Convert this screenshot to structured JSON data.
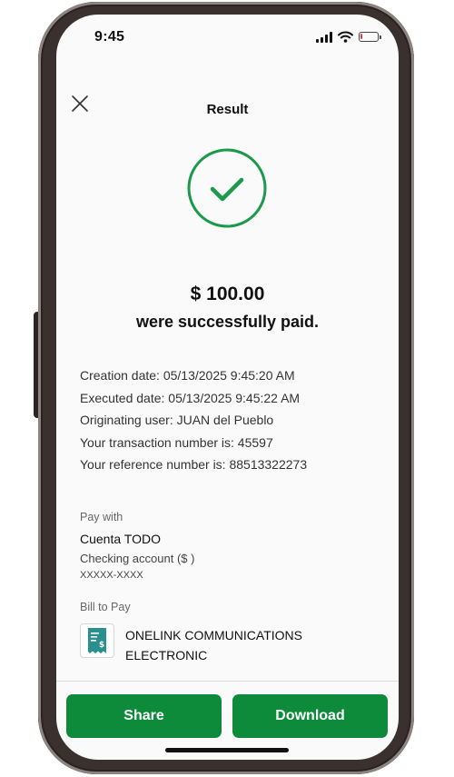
{
  "status_bar": {
    "time": "9:45",
    "battery_level": 0.12
  },
  "header": {
    "title": "Result"
  },
  "payment": {
    "amount": "$ 100.00",
    "message": "were successfully paid."
  },
  "details": [
    "Creation date: 05/13/2025 9:45:20 AM",
    "Executed date: 05/13/2025 9:45:22 AM",
    "Originating user: JUAN del Pueblo",
    "Your transaction number is: 45597",
    "Your reference number is: 88513322273"
  ],
  "pay_with": {
    "label": "Pay with",
    "account_name": "Cuenta TODO",
    "account_type": "Checking account ($ )",
    "account_masked": "XXXXX-XXXX"
  },
  "bill_to_pay": {
    "label": "Bill to Pay",
    "biller_line1": "ONELINK COMMUNICATIONS",
    "biller_line2": "ELECTRONIC"
  },
  "actions": {
    "share": "Share",
    "download": "Download"
  },
  "colors": {
    "accent": "#0d8a3a",
    "success_icon": "#1a9a4a",
    "biller_icon": "#2a8f8f",
    "battery_low": "#e23b3b"
  },
  "icons": [
    "close-icon",
    "check-circle-icon",
    "signal-icon",
    "wifi-icon",
    "battery-icon",
    "bill-receipt-icon"
  ]
}
